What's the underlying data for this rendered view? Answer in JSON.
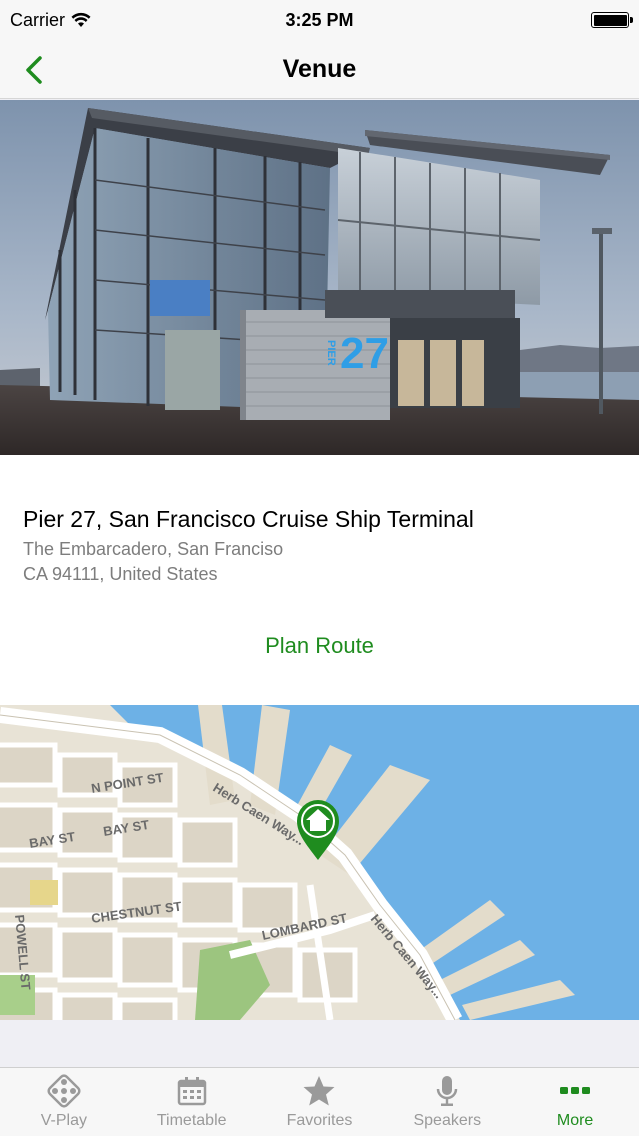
{
  "status_bar": {
    "carrier": "Carrier",
    "time": "3:25 PM"
  },
  "nav": {
    "title": "Venue"
  },
  "venue": {
    "name": "Pier 27, San Francisco Cruise Ship Terminal",
    "address_line1": "The Embarcadero, San Franciso",
    "address_line2": "CA 94111, United States",
    "plan_route_label": "Plan Route"
  },
  "hero": {
    "sign_text": "PIER 27"
  },
  "map": {
    "labels": {
      "n_point": "N POINT ST",
      "bay1": "BAY ST",
      "bay2": "BAY ST",
      "herb1": "Herb Caen Way...",
      "herb2": "Herb Caen Way...",
      "chestnut": "CHESTNUT ST",
      "lombard": "LOMBARD ST",
      "powell": "POWELL ST"
    },
    "pin_icon": "home-icon"
  },
  "tabs": [
    {
      "label": "V-Play",
      "icon": "v-play-icon",
      "active": false
    },
    {
      "label": "Timetable",
      "icon": "calendar-icon",
      "active": false
    },
    {
      "label": "Favorites",
      "icon": "star-icon",
      "active": false
    },
    {
      "label": "Speakers",
      "icon": "microphone-icon",
      "active": false
    },
    {
      "label": "More",
      "icon": "more-dots-icon",
      "active": true
    }
  ],
  "colors": {
    "accent": "#1f8c1f",
    "water": "#6db1e6",
    "inactive_tab": "#9a9a9a"
  }
}
